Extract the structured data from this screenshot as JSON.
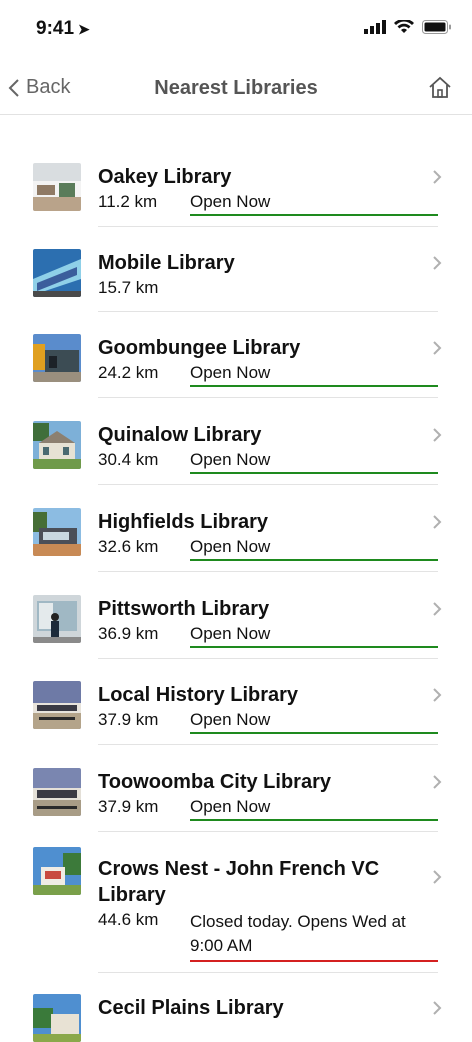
{
  "status_bar": {
    "time": "9:41"
  },
  "nav": {
    "back_label": "Back",
    "title": "Nearest Libraries"
  },
  "libraries": [
    {
      "name": "Oakey Library",
      "distance": "11.2 km",
      "status": "Open Now",
      "state": "open"
    },
    {
      "name": "Mobile Library",
      "distance": "15.7 km",
      "status": "",
      "state": "none"
    },
    {
      "name": "Goombungee Library",
      "distance": "24.2 km",
      "status": "Open Now",
      "state": "open"
    },
    {
      "name": "Quinalow Library",
      "distance": "30.4 km",
      "status": "Open Now",
      "state": "open"
    },
    {
      "name": "Highfields Library",
      "distance": "32.6 km",
      "status": "Open Now",
      "state": "open"
    },
    {
      "name": "Pittsworth Library",
      "distance": "36.9 km",
      "status": "Open Now",
      "state": "open"
    },
    {
      "name": "Local History Library",
      "distance": "37.9 km",
      "status": "Open Now",
      "state": "open"
    },
    {
      "name": "Toowoomba City Library",
      "distance": "37.9 km",
      "status": "Open Now",
      "state": "open"
    },
    {
      "name": "Crows Nest - John French VC Library",
      "distance": "44.6 km",
      "status": "Closed today. Opens Wed at 9:00 AM",
      "state": "closed"
    },
    {
      "name": "Cecil Plains Library",
      "distance": "",
      "status": "",
      "state": "none"
    }
  ],
  "colors": {
    "open": "#1e8a1e",
    "closed": "#d42020",
    "title": "#555555"
  }
}
